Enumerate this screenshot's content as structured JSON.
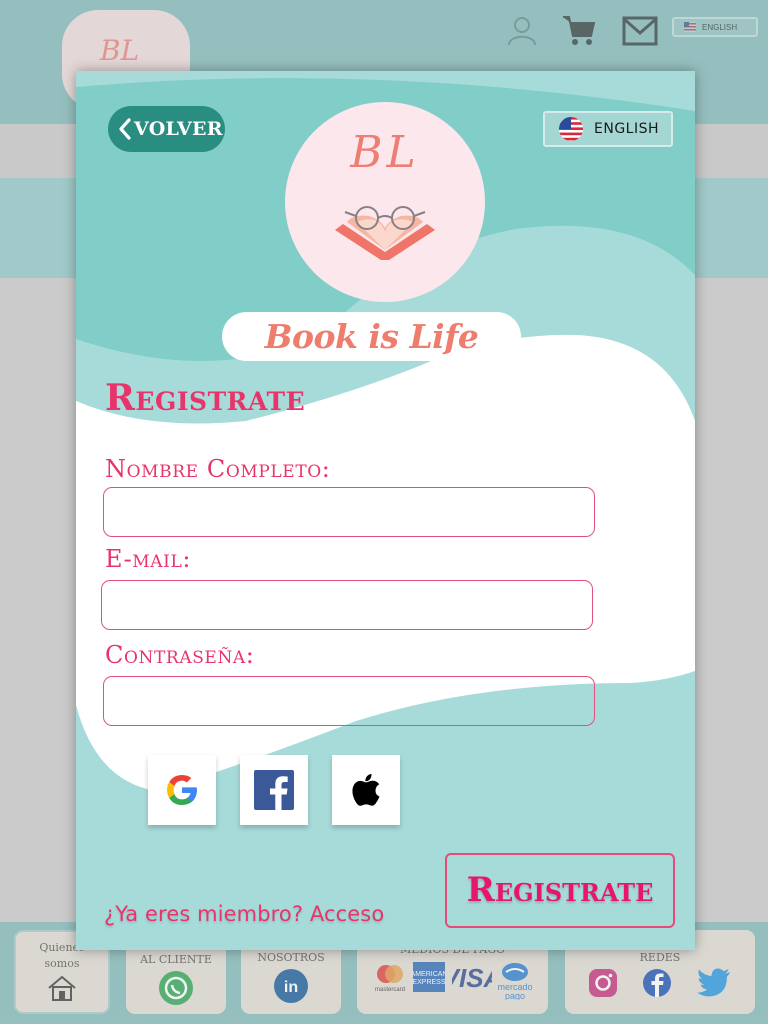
{
  "background": {
    "logo_text": "BL",
    "header_icons": [
      "user-icon",
      "cart-icon",
      "mail-icon"
    ],
    "language_label": "ENGLISH",
    "footer": {
      "cards": [
        {
          "text": "Quienes somos",
          "icon": "home-icon"
        },
        {
          "text": "Al cliente",
          "icon": "whatsapp-icon"
        },
        {
          "text": "Nosotros",
          "icon": "linkedin-icon"
        },
        {
          "text": "Medios de pago",
          "icons": [
            "mastercard-icon",
            "amex-icon",
            "visa-icon",
            "mercadopago-icon"
          ]
        },
        {
          "text": "Redes",
          "icons": [
            "instagram-icon",
            "facebook-icon",
            "twitter-icon"
          ]
        }
      ]
    }
  },
  "modal": {
    "back_label": "VOLVER",
    "language_label": "ENGLISH",
    "logo_text": "BL",
    "brand_name": "Book is Life",
    "title": "Registrate",
    "fields": {
      "name_label": "Nombre Completo:",
      "name_value": "",
      "email_label": "E-mail:",
      "email_value": "",
      "password_label": "Contraseña:",
      "password_value": ""
    },
    "social_buttons": [
      "google-icon",
      "facebook-icon",
      "apple-icon"
    ],
    "submit_label": "Registrate",
    "login_link": "¿Ya eres miembro? Acceso"
  },
  "colors": {
    "accent_pink": "#e8346a",
    "teal": "#81cdc8",
    "dark_teal": "#2a8d82",
    "logo_salmon": "#ee7d74"
  }
}
